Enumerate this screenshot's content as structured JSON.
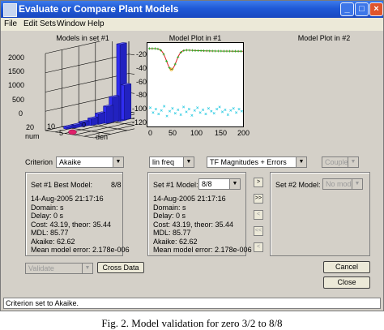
{
  "window": {
    "title": "Evaluate or Compare Plant Models"
  },
  "menu": [
    "File",
    "Edit Sets",
    "Window",
    "Help"
  ],
  "plot1": {
    "title": "Models in set #1",
    "z_ticks": [
      "2000",
      "1500",
      "1000",
      "500",
      "0"
    ],
    "x_label": "num",
    "y_label": "den",
    "x_ticks": [
      "5",
      "10",
      "20"
    ],
    "y_ticks": [
      "0"
    ],
    "colors": {
      "bars": "#2f2cf0",
      "best": "#e0206a"
    }
  },
  "plot2": {
    "title": "Model Plot in #1",
    "y_ticks": [
      "-20",
      "-40",
      "-60",
      "-80",
      "-100",
      "-120"
    ],
    "x_ticks": [
      "0",
      "50",
      "100",
      "150",
      "200"
    ],
    "colors": {
      "model": "#d62020",
      "data": "#20b020",
      "error": "#20c8e0"
    }
  },
  "plot3": {
    "title": "Model Plot in #2"
  },
  "criterion": {
    "label": "Criterion",
    "value": "Akaike"
  },
  "freq": {
    "value": "lin freq"
  },
  "display": {
    "value": "TF Magnitudes + Errors"
  },
  "coupled": {
    "value": "Coupled"
  },
  "panel_left": {
    "header": "Set #1  Best Model:",
    "header_value": "8/8",
    "lines": [
      "14-Aug-2005 21:17:16",
      "Domain: s",
      "Delay: 0 s",
      "Cost: 43.19, theor: 35.44",
      "MDL: 85.77",
      "Akaike: 62.62",
      "Mean model error: 2.178e-006"
    ]
  },
  "panel_mid": {
    "header": "Set #1  Model:",
    "model_value": "8/8",
    "lines": [
      "14-Aug-2005 21:17:16",
      "Domain: s",
      "Delay: 0 s",
      "Cost: 43.19, theor: 35.44",
      "MDL: 85.77",
      "Akaike: 62.62",
      "Mean model error: 2.178e-006"
    ]
  },
  "panel_right": {
    "header": "Set #2  Model:",
    "model_value": "No model"
  },
  "side_buttons": [
    ">",
    ">>",
    "<",
    "<<",
    "<"
  ],
  "validate": {
    "value": "Validate"
  },
  "cross_data": {
    "label": "Cross Data"
  },
  "cancel": {
    "label": "Cancel"
  },
  "close": {
    "label": "Close"
  },
  "status": {
    "text": "Criterion set to Akaike."
  },
  "caption": {
    "text": "Fig. 2. Model validation for zero 3/2 to 8/8"
  }
}
